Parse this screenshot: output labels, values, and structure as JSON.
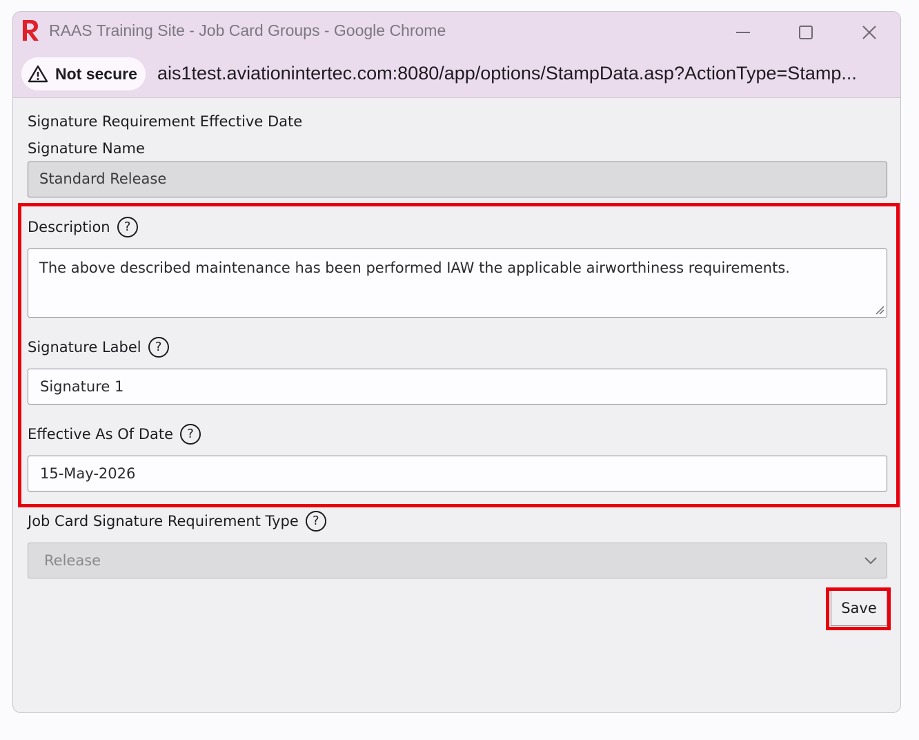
{
  "window": {
    "title": "RAAS Training Site - Job Card Groups - Google Chrome",
    "security_label": "Not secure",
    "url": "ais1test.aviationintertec.com:8080/app/options/StampData.asp?ActionType=Stamp..."
  },
  "form": {
    "section_title": "Signature Requirement Effective Date",
    "signature_name_label": "Signature Name",
    "signature_name_value": "Standard Release",
    "description_label": "Description",
    "description_value": "The above described maintenance has been performed IAW the applicable airworthiness requirements.",
    "signature_label_label": "Signature Label",
    "signature_label_value": "Signature 1",
    "effective_date_label": "Effective As Of Date",
    "effective_date_value": "15-May-2026",
    "requirement_type_label": "Job Card Signature Requirement Type",
    "requirement_type_value": "Release",
    "save_label": "Save",
    "help_glyph": "?"
  },
  "colors": {
    "highlight": "#e8000d",
    "titlebar": "#eadcec",
    "logo": "#e0202a"
  }
}
